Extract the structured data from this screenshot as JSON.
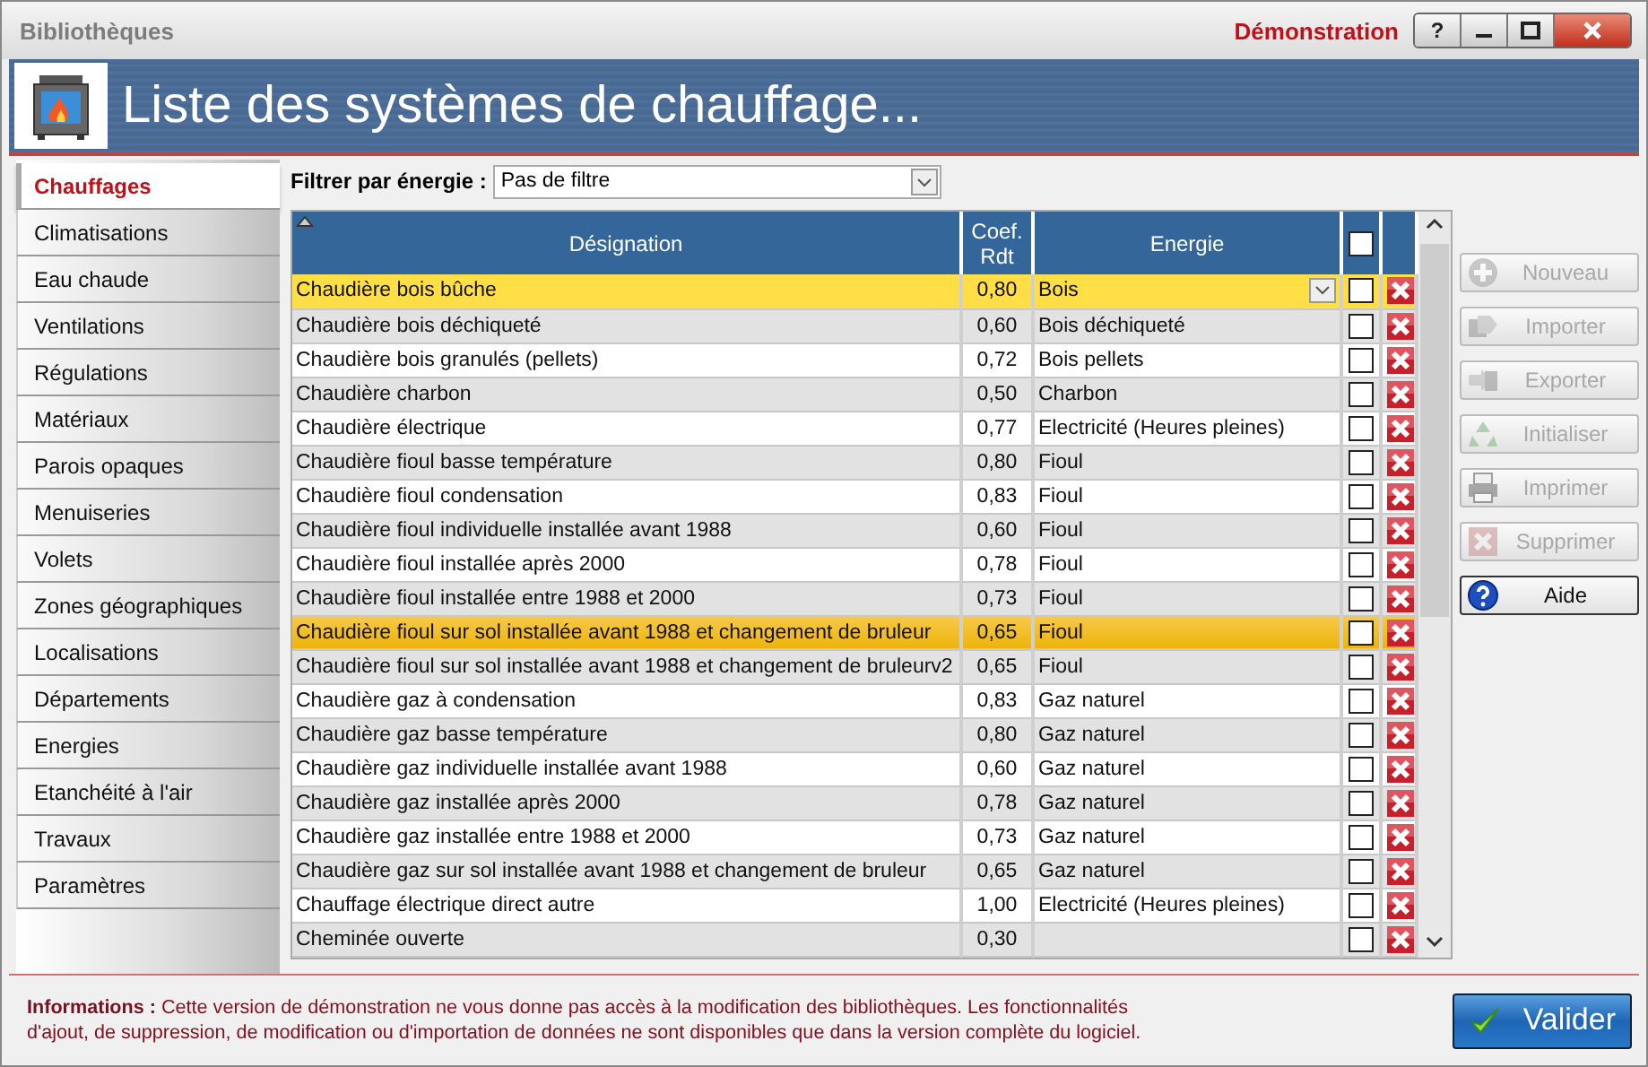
{
  "window": {
    "title": "Bibliothèques",
    "edition": "Démonstration",
    "help_button": "?"
  },
  "banner": {
    "title": "Liste des systèmes de chauffage..."
  },
  "sidebar": {
    "items": [
      {
        "label": "Chauffages",
        "selected": true
      },
      {
        "label": "Climatisations",
        "selected": false
      },
      {
        "label": "Eau chaude",
        "selected": false
      },
      {
        "label": "Ventilations",
        "selected": false
      },
      {
        "label": "Régulations",
        "selected": false
      },
      {
        "label": "Matériaux",
        "selected": false
      },
      {
        "label": "Parois opaques",
        "selected": false
      },
      {
        "label": "Menuiseries",
        "selected": false
      },
      {
        "label": "Volets",
        "selected": false
      },
      {
        "label": "Zones géographiques",
        "selected": false
      },
      {
        "label": "Localisations",
        "selected": false
      },
      {
        "label": "Départements",
        "selected": false
      },
      {
        "label": "Energies",
        "selected": false
      },
      {
        "label": "Etanchéité à l'air",
        "selected": false
      },
      {
        "label": "Travaux",
        "selected": false
      },
      {
        "label": "Paramètres",
        "selected": false
      }
    ]
  },
  "filter": {
    "label": "Filtrer par énergie :",
    "value": "Pas de filtre"
  },
  "table": {
    "columns": [
      "Désignation",
      "Coef. Rdt",
      "Energie"
    ],
    "all_checked": false,
    "rows": [
      {
        "designation": "Chaudière bois bûche",
        "coef": "0,80",
        "energie": "Bois",
        "checked": false,
        "selected": true,
        "highlighted": false
      },
      {
        "designation": "Chaudière bois déchiqueté",
        "coef": "0,60",
        "energie": "Bois déchiqueté",
        "checked": false,
        "selected": false,
        "highlighted": false
      },
      {
        "designation": "Chaudière bois granulés (pellets)",
        "coef": "0,72",
        "energie": "Bois pellets",
        "checked": false,
        "selected": false,
        "highlighted": false
      },
      {
        "designation": "Chaudière charbon",
        "coef": "0,50",
        "energie": "Charbon",
        "checked": false,
        "selected": false,
        "highlighted": false
      },
      {
        "designation": "Chaudière électrique",
        "coef": "0,77",
        "energie": "Electricité (Heures pleines)",
        "checked": false,
        "selected": false,
        "highlighted": false
      },
      {
        "designation": "Chaudière fioul basse température",
        "coef": "0,80",
        "energie": "Fioul",
        "checked": false,
        "selected": false,
        "highlighted": false
      },
      {
        "designation": "Chaudière fioul condensation",
        "coef": "0,83",
        "energie": "Fioul",
        "checked": false,
        "selected": false,
        "highlighted": false
      },
      {
        "designation": "Chaudière fioul individuelle installée avant 1988",
        "coef": "0,60",
        "energie": "Fioul",
        "checked": false,
        "selected": false,
        "highlighted": false
      },
      {
        "designation": "Chaudière fioul installée après 2000",
        "coef": "0,78",
        "energie": "Fioul",
        "checked": false,
        "selected": false,
        "highlighted": false
      },
      {
        "designation": "Chaudière fioul installée entre 1988 et 2000",
        "coef": "0,73",
        "energie": "Fioul",
        "checked": false,
        "selected": false,
        "highlighted": false
      },
      {
        "designation": "Chaudière fioul sur sol installée avant 1988 et changement de bruleur",
        "coef": "0,65",
        "energie": "Fioul",
        "checked": false,
        "selected": false,
        "highlighted": true
      },
      {
        "designation": "Chaudière fioul sur sol installée avant 1988 et changement de bruleurv2",
        "coef": "0,65",
        "energie": "Fioul",
        "checked": false,
        "selected": false,
        "highlighted": false
      },
      {
        "designation": "Chaudière gaz à condensation",
        "coef": "0,83",
        "energie": "Gaz naturel",
        "checked": false,
        "selected": false,
        "highlighted": false
      },
      {
        "designation": "Chaudière gaz basse température",
        "coef": "0,80",
        "energie": "Gaz naturel",
        "checked": false,
        "selected": false,
        "highlighted": false
      },
      {
        "designation": "Chaudière gaz individuelle installée avant 1988",
        "coef": "0,60",
        "energie": "Gaz naturel",
        "checked": false,
        "selected": false,
        "highlighted": false
      },
      {
        "designation": "Chaudière gaz installée après 2000",
        "coef": "0,78",
        "energie": "Gaz naturel",
        "checked": false,
        "selected": false,
        "highlighted": false
      },
      {
        "designation": "Chaudière gaz installée entre 1988 et 2000",
        "coef": "0,73",
        "energie": "Gaz naturel",
        "checked": false,
        "selected": false,
        "highlighted": false
      },
      {
        "designation": "Chaudière gaz sur sol installée avant 1988 et changement de bruleur",
        "coef": "0,65",
        "energie": "Gaz naturel",
        "checked": false,
        "selected": false,
        "highlighted": false
      },
      {
        "designation": "Chauffage électrique direct autre",
        "coef": "1,00",
        "energie": "Electricité (Heures pleines)",
        "checked": false,
        "selected": false,
        "highlighted": false
      },
      {
        "designation": "Cheminée ouverte",
        "coef": "0,30",
        "energie": "",
        "checked": false,
        "selected": false,
        "highlighted": false
      }
    ]
  },
  "actions": [
    {
      "label": "Nouveau",
      "kind": "new",
      "disabled": true
    },
    {
      "label": "Importer",
      "kind": "import",
      "disabled": true
    },
    {
      "label": "Exporter",
      "kind": "export",
      "disabled": true
    },
    {
      "label": "Initialiser",
      "kind": "reset",
      "disabled": true
    },
    {
      "label": "Imprimer",
      "kind": "print",
      "disabled": true
    },
    {
      "label": "Supprimer",
      "kind": "delete",
      "disabled": true
    },
    {
      "label": "Aide",
      "kind": "help",
      "disabled": false
    }
  ],
  "info": {
    "text": "**Informations :** Cette version de démonstration ne vous donne pas accès à la modification des bibliothèques. Les fonctionnalités d'ajout, de suppression, de modification ou d'importation de données ne sont disponibles que dans la version complète du logiciel."
  },
  "validate_button": "Valider"
}
